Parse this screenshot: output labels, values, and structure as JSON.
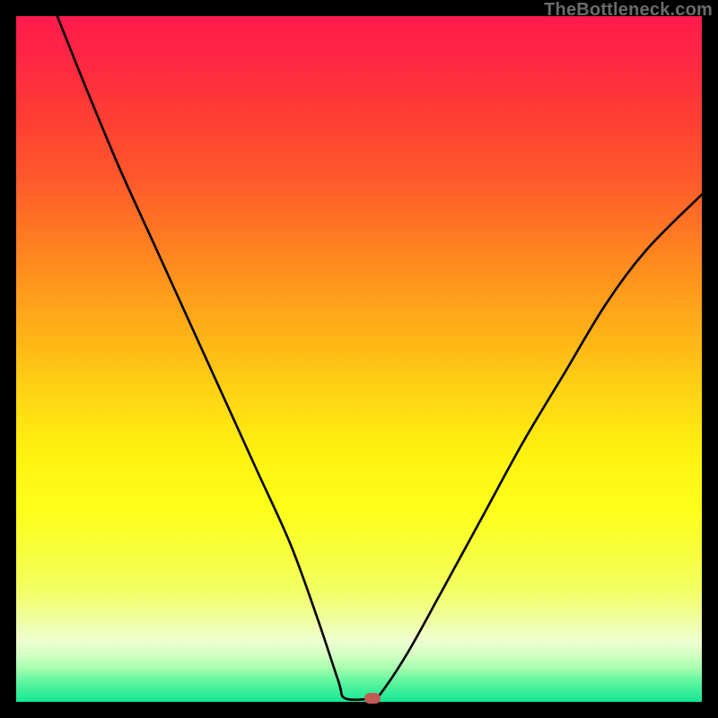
{
  "watermark": "TheBottleneck.com",
  "chart_data": {
    "type": "line",
    "title": "",
    "xlabel": "",
    "ylabel": "",
    "xlim": [
      0,
      100
    ],
    "ylim": [
      0,
      100
    ],
    "curve": [
      {
        "x": 6,
        "y": 100
      },
      {
        "x": 10,
        "y": 90
      },
      {
        "x": 15,
        "y": 78
      },
      {
        "x": 20,
        "y": 67
      },
      {
        "x": 25,
        "y": 56
      },
      {
        "x": 30,
        "y": 45
      },
      {
        "x": 35,
        "y": 34
      },
      {
        "x": 40,
        "y": 23
      },
      {
        "x": 44,
        "y": 12
      },
      {
        "x": 47,
        "y": 3
      },
      {
        "x": 48,
        "y": 0.5
      },
      {
        "x": 52,
        "y": 0.5
      },
      {
        "x": 53,
        "y": 1
      },
      {
        "x": 57,
        "y": 7
      },
      {
        "x": 62,
        "y": 16
      },
      {
        "x": 68,
        "y": 27
      },
      {
        "x": 74,
        "y": 38
      },
      {
        "x": 80,
        "y": 48
      },
      {
        "x": 86,
        "y": 58
      },
      {
        "x": 92,
        "y": 66
      },
      {
        "x": 100,
        "y": 74
      }
    ],
    "marker": {
      "x": 52,
      "y": 0.5,
      "color": "#c45a55"
    },
    "background": "rainbow-vertical",
    "frame_color": "#000000"
  }
}
